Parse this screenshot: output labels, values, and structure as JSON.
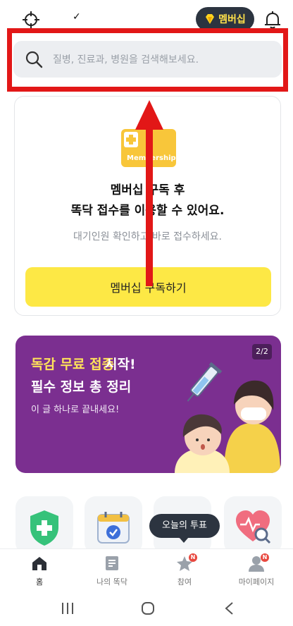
{
  "topbar": {
    "check_mark": "✓",
    "membership_label": "멤버십"
  },
  "search": {
    "placeholder": "질병, 진료과, 병원을 검색해보세요."
  },
  "membership_card": {
    "icon_text": "Membership",
    "title_line1": "멤버십 구독 후",
    "title_line2": "똑닥 접수를 이용할 수 있어요.",
    "subtitle": "대기인원 확인하고 바로 접수하세요.",
    "cta_label": "멤버십 구독하기"
  },
  "banner": {
    "title_yellow": "독감 무료 접종",
    "title_white": "시작!",
    "title_line2": "필수 정보 총 정리",
    "subtitle": "이 글 하나로 끝내세요!",
    "page_indicator": "2/2"
  },
  "tooltip": {
    "label": "오늘의 투표"
  },
  "bottom_nav": {
    "items": [
      {
        "label": "홈",
        "icon": "home-icon",
        "active": true
      },
      {
        "label": "나의 똑닥",
        "icon": "document-icon",
        "active": false
      },
      {
        "label": "참여",
        "icon": "star-speech-icon",
        "active": false,
        "badge": "N"
      },
      {
        "label": "마이페이지",
        "icon": "person-icon",
        "active": false,
        "badge": "N"
      }
    ]
  },
  "colors": {
    "accent_yellow": "#fde845",
    "banner_purple": "#7b2f90",
    "annotation_red": "#e21717",
    "dark_pill": "#2c3440"
  }
}
